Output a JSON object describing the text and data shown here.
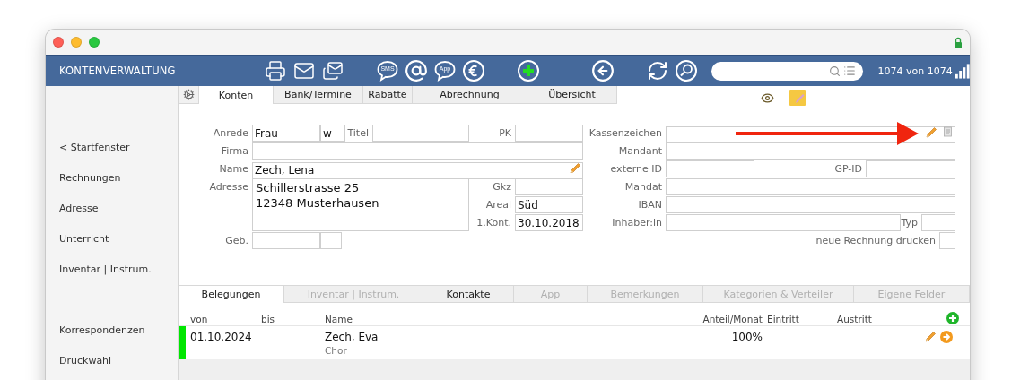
{
  "toolbar": {
    "title": "KONTENVERWALTUNG",
    "groups": [
      [
        {
          "kind": "printer"
        },
        {
          "kind": "mail"
        },
        {
          "kind": "mails"
        }
      ],
      [
        {
          "kind": "bubble",
          "label": "SMS"
        },
        {
          "kind": "at"
        },
        {
          "kind": "bubble",
          "label": "App"
        },
        {
          "kind": "euro"
        }
      ],
      [
        {
          "kind": "add"
        }
      ],
      [
        {
          "kind": "back"
        }
      ],
      [
        {
          "kind": "refresh"
        },
        {
          "kind": "find"
        }
      ]
    ],
    "counter": "1074 von 1074"
  },
  "sidebar": {
    "groups": [
      [
        {
          "label": "< Startfenster"
        },
        {
          "label": "Rechnungen"
        },
        {
          "label": "Adresse"
        },
        {
          "label": "Unterricht"
        },
        {
          "label": "Inventar | Instrum."
        }
      ],
      [
        {
          "label": "Korrespondenzen"
        },
        {
          "label": "Druckwahl"
        }
      ]
    ]
  },
  "tabs": [
    {
      "label": "Konten",
      "selected": true
    },
    {
      "label": "Bank/Termine",
      "selected": false
    },
    {
      "label": "Rabatte",
      "selected": false
    },
    {
      "label": "Abrechnung",
      "selected": false
    },
    {
      "label": "Übersicht",
      "selected": false
    }
  ],
  "form": {
    "anrede": {
      "label": "Anrede",
      "value": "Frau",
      "gender": "w"
    },
    "titel": {
      "label": "Titel"
    },
    "pk": {
      "label": "PK"
    },
    "firma": {
      "label": "Firma"
    },
    "name": {
      "label": "Name",
      "value": "Zech, Lena"
    },
    "adresse": {
      "label": "Adresse",
      "lines": [
        "Schillerstrasse 25",
        "12348 Musterhausen"
      ]
    },
    "gkz": {
      "label": "Gkz"
    },
    "areal": {
      "label": "Areal",
      "value": "Süd"
    },
    "erstkontakt": {
      "label": "1.Kont.",
      "value": "30.10.2018"
    },
    "geb": {
      "label": "Geb."
    },
    "kassenzeichen": {
      "label": "Kassenzeichen"
    },
    "mandant": {
      "label": "Mandant"
    },
    "externe_id": {
      "label": "externe ID"
    },
    "gp_id": {
      "label": "GP-ID"
    },
    "mandat": {
      "label": "Mandat"
    },
    "iban": {
      "label": "IBAN"
    },
    "inhaber": {
      "label": "Inhaber:in"
    },
    "typ": {
      "label": "Typ"
    },
    "neue_rechnung": {
      "label": "neue Rechnung drucken",
      "checked": false
    }
  },
  "bottom_tabs": [
    {
      "label": "Belegungen",
      "selected": true,
      "disabled": false
    },
    {
      "label": "Inventar | Instrum.",
      "selected": false,
      "disabled": true
    },
    {
      "label": "Kontakte",
      "selected": false,
      "disabled": false
    },
    {
      "label": "App",
      "selected": false,
      "disabled": true
    },
    {
      "label": "Bemerkungen",
      "selected": false,
      "disabled": true
    },
    {
      "label": "Kategorien & Verteiler",
      "selected": false,
      "disabled": true
    },
    {
      "label": "Eigene Felder",
      "selected": false,
      "disabled": true
    }
  ],
  "belegungen": {
    "columns": [
      "von",
      "bis",
      "Name",
      "Anteil/Monat",
      "Eintritt",
      "Austritt"
    ],
    "rows": [
      {
        "von": "01.10.2024",
        "name": "Zech, Eva",
        "note": "Chor",
        "anteil": "100%",
        "color": "#00e600"
      }
    ]
  }
}
